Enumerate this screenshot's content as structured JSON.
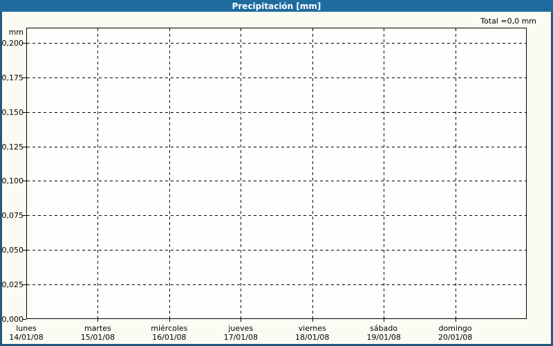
{
  "window": {
    "title": "Precipitación [mm]"
  },
  "summary": {
    "total_text": "Total =0,0 mm"
  },
  "axes": {
    "y_unit_label": "mm"
  },
  "colors": {
    "header_bg": "#1e6b9f",
    "header_text": "#ffffff",
    "frame_border": "#26587f",
    "page_bg": "#fafcf3",
    "plot_bg": "#fefefd",
    "grid": "#000000",
    "text": "#000000"
  },
  "chart_data": {
    "type": "bar",
    "title": "Precipitación [mm]",
    "total_annotation": "Total =0,0 mm",
    "total_mm": 0.0,
    "ylabel": "mm",
    "ylim": [
      0,
      0.211
    ],
    "grid": "dashed-both-axes",
    "legend": "none",
    "x_divisions": 7,
    "yticks": {
      "values": [
        0.0,
        0.025,
        0.05,
        0.075,
        0.1,
        0.125,
        0.15,
        0.175,
        0.2
      ],
      "labels": [
        "0,000",
        "0,025",
        "0,050",
        "0,075",
        "0,100",
        "0,125",
        "0,150",
        "0,175",
        "0,200"
      ]
    },
    "categories": [
      {
        "day": "lunes",
        "date": "14/01/08"
      },
      {
        "day": "martes",
        "date": "15/01/08"
      },
      {
        "day": "miércoles",
        "date": "16/01/08"
      },
      {
        "day": "jueves",
        "date": "17/01/08"
      },
      {
        "day": "viernes",
        "date": "18/01/08"
      },
      {
        "day": "sábado",
        "date": "19/01/08"
      },
      {
        "day": "domingo",
        "date": "20/01/08"
      }
    ],
    "series": [
      {
        "name": "Precipitación",
        "values": [
          0,
          0,
          0,
          0,
          0,
          0,
          0
        ]
      }
    ]
  }
}
